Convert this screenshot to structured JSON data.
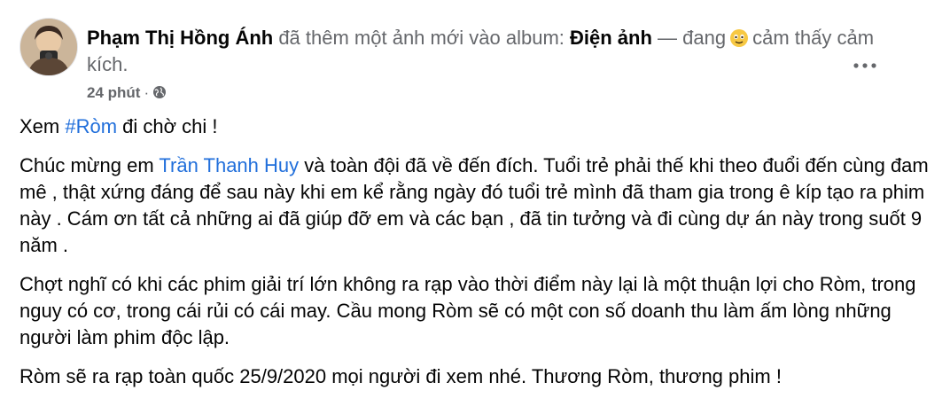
{
  "header": {
    "author_name": "Phạm Thị Hồng Ánh",
    "action_text": " đã thêm một ảnh mới vào album: ",
    "album_name": "Điện ảnh",
    "feeling_prefix": " — đang",
    "feeling_text": "cảm thấy cảm kích.",
    "timestamp": "24 phút",
    "separator": "·",
    "privacy_icon": "globe-icon",
    "more_icon": "more-options-icon"
  },
  "post": {
    "p1_prefix": "Xem ",
    "p1_hashtag": "#Ròm",
    "p1_suffix": " đi chờ chi  !",
    "p2_prefix": "Chúc mừng em ",
    "p2_mention": "Trần Thanh Huy",
    "p2_suffix": " và toàn đội đã về đến đích. Tuổi trẻ phải thế khi theo đuổi đến cùng đam mê , thật xứng đáng để sau này khi em kể rằng ngày đó tuổi trẻ mình đã tham gia trong ê kíp tạo ra phim này . Cám ơn tất cả những ai đã giúp đỡ em và các bạn , đã tin tưởng và đi cùng dự án này trong suốt 9 năm .",
    "p3": "Chợt nghĩ có khi các phim giải trí lớn không ra rạp vào thời điểm này lại là một thuận lợi cho Ròm, trong nguy có cơ, trong cái rủi có cái may. Cầu mong Ròm sẽ có một con số doanh thu làm ấm lòng những người làm phim độc lập.",
    "p4": "Ròm sẽ ra rạp toàn quốc 25/9/2020 mọi người đi xem nhé. Thương Ròm, thương phim !"
  },
  "colors": {
    "link": "#216fdb",
    "secondary_text": "#65676b",
    "primary_text": "#050505"
  }
}
